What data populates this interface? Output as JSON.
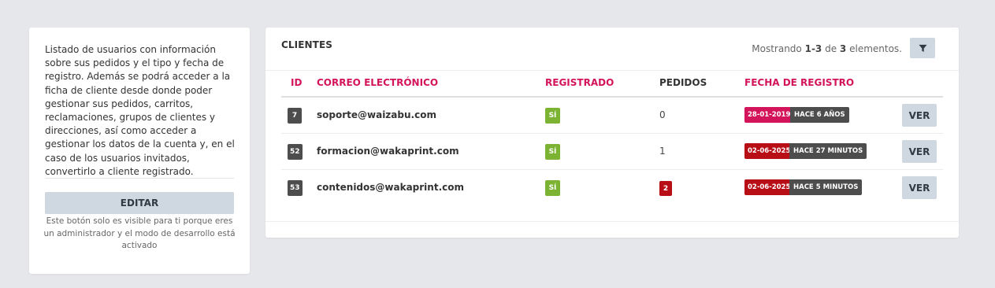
{
  "sidebar": {
    "description": "Listado de usuarios con información sobre sus pedidos y el tipo y fecha de registro. Además se podrá acceder a la ficha de cliente desde donde poder gestionar sus pedidos, carritos, reclamaciones, grupos de clientes y direcciones, así como acceder a gestionar los datos de la cuenta y, en el caso de los usuarios invitados, convertirlo a cliente registrado.",
    "edit_label": "EDITAR",
    "edit_note": "Este botón solo es visible para ti porque eres un administrador y el modo de desarrollo está activado"
  },
  "main": {
    "title": "CLIENTES",
    "summary": {
      "prefix": "Mostrando ",
      "range": "1-3",
      "middle": " de ",
      "total": "3",
      "suffix": " elementos."
    },
    "filter_icon": "filter-icon",
    "columns": {
      "id": "ID",
      "email": "CORREO ELECTRÓNICO",
      "registered": "REGISTRADO",
      "orders": "PEDIDOS",
      "date": "FECHA DE REGISTRO"
    },
    "rows": [
      {
        "id": "7",
        "email": "soporte@waizabu.com",
        "registered": "SÍ",
        "orders": "0",
        "date": "28-01-2019",
        "ago": "HACE 6 AÑOS",
        "view_label": "VER"
      },
      {
        "id": "52",
        "email": "formacion@wakaprint.com",
        "registered": "SÍ",
        "orders": "1",
        "date": "02-06-2025",
        "ago": "HACE 27 MINUTOS",
        "view_label": "VER"
      },
      {
        "id": "53",
        "email": "contenidos@wakaprint.com",
        "registered": "SÍ",
        "orders": "2",
        "date": "02-06-2025",
        "ago": "HACE 5 MINUTOS",
        "view_label": "VER"
      }
    ]
  },
  "colors": {
    "accent": "#d4145a",
    "registered_green": "#7cb332",
    "recent_red": "#b80f17",
    "dark_badge": "#4d4d4d",
    "button_bg": "#cfd8e0"
  }
}
